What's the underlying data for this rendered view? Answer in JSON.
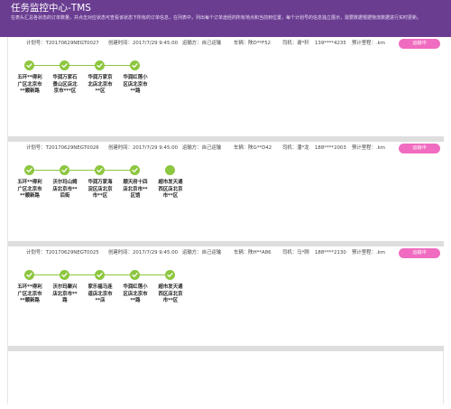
{
  "header": {
    "title": "任务监控中心-TMS",
    "description": "在表头汇总各状态的订单数量，并点击对应状态可查看该状态下所有的订单信息，在列表中，列出每个订单途经的所有地点和当前到位置，每个计划号的信息独立展示，需要数据根据物流数据进行实时更新。"
  },
  "tasks": [
    {
      "plan_no": "计划号：T20170629NEGT0027",
      "created_time": "创建时间：2017/7/29 9:45:00",
      "method": "运输方：自己运输",
      "plate": "车辆：陕D**F52",
      "driver": "司机：谢*轩",
      "phone": "139****4235",
      "mileage": "预计里程：.km",
      "status_label": "运输中",
      "stops": [
        {
          "label": "五环**得利广区北京市**顺新路",
          "done": true
        },
        {
          "label": "华润万家石景山区店北京市***区",
          "done": true
        },
        {
          "label": "华润万家京北店北京市**区",
          "done": true
        },
        {
          "label": "华润红莲小区店北京市**路",
          "done": true
        }
      ]
    },
    {
      "plan_no": "计划号：T20170629NEGT0026",
      "created_time": "创建时间：2017/7/29 9:45:00",
      "method": "运输方：自己运输",
      "plate": "车辆：陕G**D42",
      "driver": "司机：潘*龙",
      "phone": "188****2003",
      "mileage": "预计里程：.km",
      "status_label": "运输中",
      "stops": [
        {
          "label": "五环**得利广区北京市**顺新路",
          "done": true
        },
        {
          "label": "沃尔玛山姆店北京市**后街",
          "done": true
        },
        {
          "label": "华润万家海淀区店北京市**区",
          "done": true
        },
        {
          "label": "顺天府十四店北京市**区馆",
          "done": true
        },
        {
          "label": "超市发天通西区店北京市**区",
          "done": false
        }
      ]
    },
    {
      "plan_no": "计划号：T20170629NEGT0025",
      "created_time": "创建时间：2017/7/29 9:45:00",
      "method": "运输方：自己运输",
      "plate": "车辆：陕H**A86",
      "driver": "司机：马*刚",
      "phone": "188****2130",
      "mileage": "预计里程：.km",
      "status_label": "运输中",
      "stops": [
        {
          "label": "五环**得利广区北京市**顺新路",
          "done": true
        },
        {
          "label": "沃尔玛聚兴店北京市**路",
          "done": true
        },
        {
          "label": "家乐福马连道店北京市**店",
          "done": true
        },
        {
          "label": "华润红莲小区店北京市**路",
          "done": true
        },
        {
          "label": "超市发天通西区店北京市**区",
          "done": true
        }
      ]
    }
  ],
  "colors": {
    "header_bg": "#6a3d91",
    "accent_green": "#8dc63f",
    "status_pink": "#f06cc0",
    "separator_gray": "#dedede"
  },
  "icons": {
    "stop_done": "checkmark-icon",
    "stop_pending": "dot-icon"
  }
}
